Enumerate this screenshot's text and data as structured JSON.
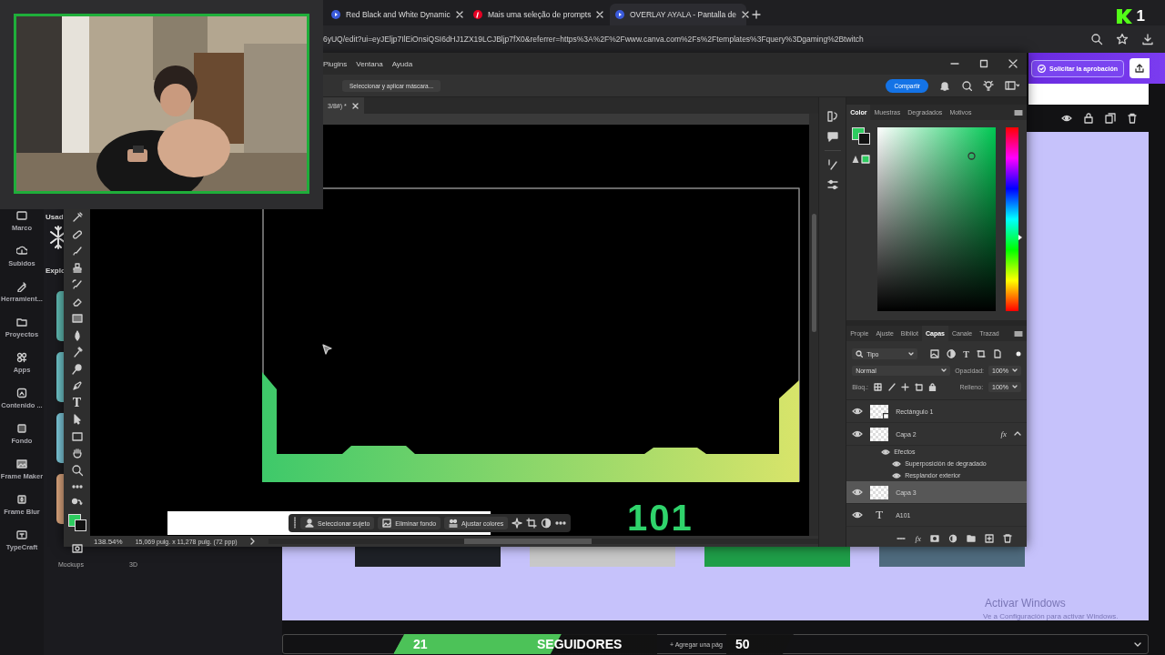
{
  "browser": {
    "tabs": [
      {
        "kind": "play",
        "label": "Red Black and White Dynamic",
        "selected": false
      },
      {
        "kind": "pin",
        "label": "Mais uma seleção de prompts",
        "selected": false
      },
      {
        "kind": "play",
        "label": "OVERLAY AYALA - Pantalla de",
        "selected": true
      }
    ],
    "url": "6yUQ/edit?ui=eyJEljp7IlEiOnsiQSI6dHJ1ZX19LCJBljp7fX0&referrer=https%3A%2F%2Fwww.canva.com%2Fs%2Ftemplates%3Fquery%3Dgaming%2Btwitch"
  },
  "channel_badge": {
    "count": "1"
  },
  "canva": {
    "approval_button": "Solicitar la aprobación",
    "sidebar": [
      {
        "label": "Marco"
      },
      {
        "label": "Subidos"
      },
      {
        "label": "Herramient..."
      },
      {
        "label": "Proyectos"
      },
      {
        "label": "Apps"
      },
      {
        "label": "Contenido ..."
      },
      {
        "label": "Fondo"
      },
      {
        "label": "Frame Maker"
      },
      {
        "label": "Frame Blur"
      },
      {
        "label": "TypeCraft"
      }
    ],
    "panel": {
      "section_1": "Usad",
      "section_2": "Explo",
      "footer_labels": [
        "Mockups",
        "3D"
      ]
    },
    "swatches": [
      {
        "color": "#1e2127"
      },
      {
        "color": "#c8c8c8"
      },
      {
        "color": "#1f9e48"
      },
      {
        "color": "#4f6b7e"
      }
    ],
    "add_page": "+ Agregar una pág"
  },
  "photoshop": {
    "menu": [
      "Plugins",
      "Ventana",
      "Ayuda"
    ],
    "options_button": "Seleccionar y aplicar máscara...",
    "share_button": "Compartir",
    "document_tab": "3/8#) *",
    "type_tool": "T",
    "canvas_text": "101",
    "taskbar": [
      "Seleccionar sujeto",
      "Eliminar fondo",
      "Ajustar colores"
    ],
    "zoom": "138.54%",
    "document_size": "15,069 pulg. x 11,278 pulg. (72 ppp)",
    "color_panel": {
      "hue_slider": {
        "level": 0.4
      },
      "tabs": [
        {
          "label": "Color",
          "selected": true
        },
        {
          "label": "Muestras",
          "selected": false
        },
        {
          "label": "Degradados",
          "selected": false
        },
        {
          "label": "Motivos",
          "selected": false
        }
      ]
    },
    "layers_panel": {
      "tabs": [
        {
          "label": "Propie",
          "selected": false
        },
        {
          "label": "Ajuste",
          "selected": false
        },
        {
          "label": "Bibliot",
          "selected": false
        },
        {
          "label": "Capas",
          "selected": true
        },
        {
          "label": "Canale",
          "selected": false
        },
        {
          "label": "Trazad",
          "selected": false
        }
      ],
      "filter": "Tipo",
      "filter_type_glyph": "T",
      "blend_mode": "Normal",
      "opacity_label": "Opacidad:",
      "opacity": "100%",
      "lock_label": "Bloq.:",
      "fill_label": "Relleno:",
      "fill": "100%",
      "layers": [
        {
          "name": "Rectángulo 1",
          "kind": "shape",
          "visible": true,
          "selected": false
        },
        {
          "name": "Capa 2",
          "kind": "pixel",
          "visible": true,
          "selected": false,
          "effects_badge": "fx",
          "effects": [
            {
              "label": "Efectos",
              "visible": true,
              "children": [
                {
                  "label": "Superposición de degradado",
                  "visible": true
                },
                {
                  "label": "Resplandor exterior",
                  "visible": true
                }
              ]
            }
          ]
        },
        {
          "name": "Capa 3",
          "kind": "pixel",
          "visible": true,
          "selected": true
        },
        {
          "name": "A101",
          "kind": "text",
          "glyph": "T",
          "visible": true,
          "selected": false
        }
      ],
      "footer_fx": "fx"
    }
  },
  "follower_goal": {
    "current": "21",
    "label": "SEGUIDORES",
    "goal": "50",
    "level": 0.42
  },
  "windows_notice": {
    "title": "Activar Windows",
    "subtitle": "Ve a Configuración para activar Windows."
  }
}
